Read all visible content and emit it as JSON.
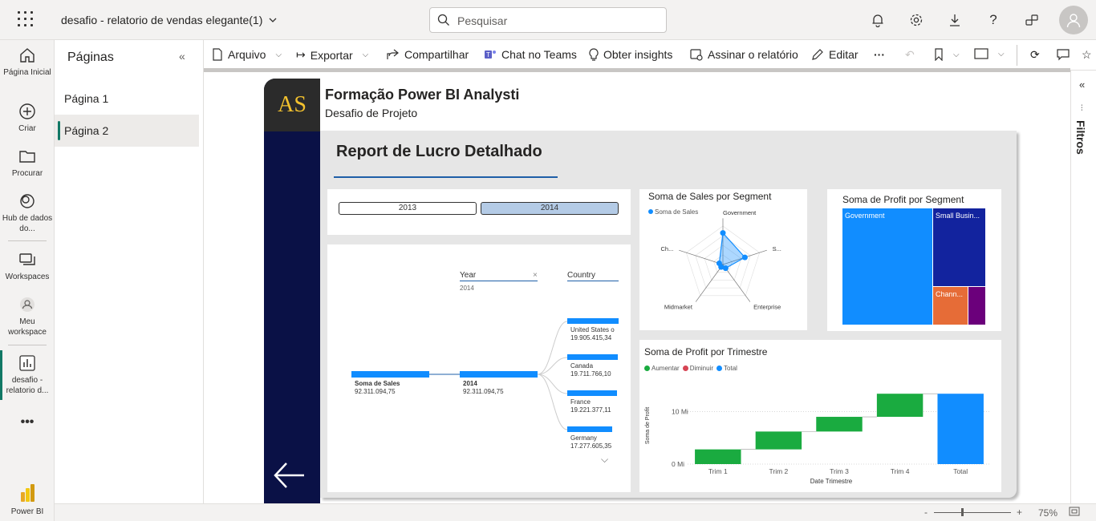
{
  "app": {
    "report_name": "desafio - relatorio de vendas elegante(1)",
    "search_placeholder": "Pesquisar",
    "brand": "Power BI"
  },
  "leftnav": [
    {
      "label": "Página Inicial",
      "icon": "home-icon"
    },
    {
      "label": "Criar",
      "icon": "plus-circle-icon"
    },
    {
      "label": "Procurar",
      "icon": "folder-icon"
    },
    {
      "label": "Hub de dados do...",
      "icon": "data-hub-icon"
    },
    {
      "label": "Workspaces",
      "icon": "workspaces-icon"
    },
    {
      "label": "Meu workspace",
      "icon": "person-icon"
    },
    {
      "label": "desafio - relatorio d...",
      "icon": "report-icon"
    }
  ],
  "pages_panel": {
    "title": "Páginas",
    "pages": [
      "Página 1",
      "Página 2"
    ],
    "active": "Página 2"
  },
  "toolbar": {
    "file": "Arquivo",
    "export": "Exportar",
    "share": "Compartilhar",
    "teams": "Chat no Teams",
    "insights": "Obter insights",
    "subscribe": "Assinar o relatório",
    "edit": "Editar"
  },
  "filters_label": "Filtros",
  "status": {
    "zoom": "75%",
    "minus": "-",
    "plus": "+"
  },
  "report": {
    "logo": "AS",
    "title": "Formação Power BI Analysti",
    "subtitle": "Desafio de Projeto",
    "heading": "Report de Lucro Detalhado",
    "slicer": {
      "options": [
        "2013",
        "2014"
      ],
      "selected": "2014"
    },
    "decomp": {
      "year_header": "Year",
      "year_value": "2014",
      "country_header": "Country",
      "root": {
        "label": "Soma de Sales",
        "value": "92.311.094,75"
      },
      "level1": {
        "label": "2014",
        "value": "92.311.094,75"
      },
      "countries": [
        {
          "label": "United States o",
          "value": "19.905.415,34",
          "fill": 1.0
        },
        {
          "label": "Canada",
          "value": "19.711.766,10",
          "fill": 0.99
        },
        {
          "label": "France",
          "value": "19.221.377,11",
          "fill": 0.966
        },
        {
          "label": "Germany",
          "value": "17.277.605,35",
          "fill": 0.868
        }
      ]
    },
    "radar": {
      "title": "Soma de Sales por Segment",
      "legend": "Soma de Sales",
      "axes": [
        "Government",
        "S...",
        "Enterprise",
        "Midmarket",
        "Ch..."
      ],
      "values": [
        0.82,
        0.6,
        0.12,
        0.08,
        0.1
      ],
      "color": "#118dff"
    },
    "treemap": {
      "title": "Soma de Profit por Segment",
      "cells": [
        {
          "label": "Government",
          "color": "#118dff"
        },
        {
          "label": "Small Busin...",
          "color": "#12239e"
        },
        {
          "label": "Chann...",
          "color": "#e66c37"
        },
        {
          "label": "",
          "color": "#6b007b"
        }
      ]
    }
  },
  "chart_data": {
    "type": "waterfall",
    "title": "Soma de Profit por Trimestre",
    "xlabel": "Date Trimestre",
    "ylabel": "Soma de Profit",
    "legend": [
      {
        "name": "Aumentar",
        "color": "#1aab40"
      },
      {
        "name": "Diminuir",
        "color": "#d64554"
      },
      {
        "name": "Total",
        "color": "#118dff"
      }
    ],
    "categories": [
      "Trim 1",
      "Trim 2",
      "Trim 3",
      "Trim 4",
      "Total"
    ],
    "values": [
      2.8,
      3.4,
      2.8,
      4.4,
      13.4
    ],
    "y_ticks": [
      "0 Mi",
      "10 Mi"
    ],
    "ylim": [
      0,
      14.5
    ]
  }
}
